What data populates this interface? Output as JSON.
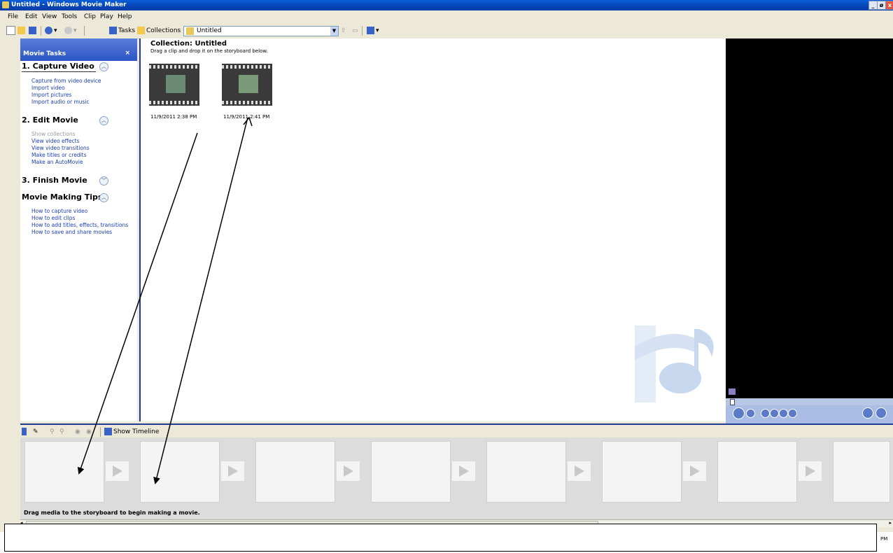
{
  "window": {
    "title": "Untitled - Windows Movie Maker",
    "buttons": [
      "_",
      "ø",
      "x"
    ]
  },
  "menu": [
    "File",
    "Edit",
    "View",
    "Tools",
    "Clip",
    "Play",
    "Help"
  ],
  "toolbar": {
    "tasks_label": "Tasks",
    "collections_label": "Collections",
    "collection_value": "Untitled"
  },
  "task_pane": {
    "header": "Movie Tasks",
    "close": "×",
    "sections": [
      {
        "title": "1. Capture Video",
        "links": [
          "Capture from video device",
          "Import video",
          "Import pictures",
          "Import audio or music"
        ]
      },
      {
        "title": "2. Edit Movie",
        "links": [
          "Show collections",
          "View video effects",
          "View video transitions",
          "Make titles or credits",
          "Make an AutoMovie"
        ]
      },
      {
        "title": "3. Finish Movie",
        "links": []
      },
      {
        "title": "Movie Making Tips",
        "links": [
          "How to capture video",
          "How to edit clips",
          "How to add titles, effects, transitions",
          "How to save and share movies"
        ]
      }
    ]
  },
  "collection": {
    "title": "Collection: Untitled",
    "subtitle": "Drag a clip and drop it on the storyboard below.",
    "clips": [
      {
        "label": "11/9/2011 2:38 PM"
      },
      {
        "label": "11/9/2011 2:41 PM"
      }
    ]
  },
  "storyboard": {
    "show_timeline_label": "Show Timeline",
    "status": "Drag media to the storyboard to begin making a movie."
  },
  "clock": "PM",
  "colors": {
    "titlebar": "#0a5fd8",
    "task_header": "#2c55c4",
    "link": "#1b3fb3",
    "preview": "#000000"
  }
}
